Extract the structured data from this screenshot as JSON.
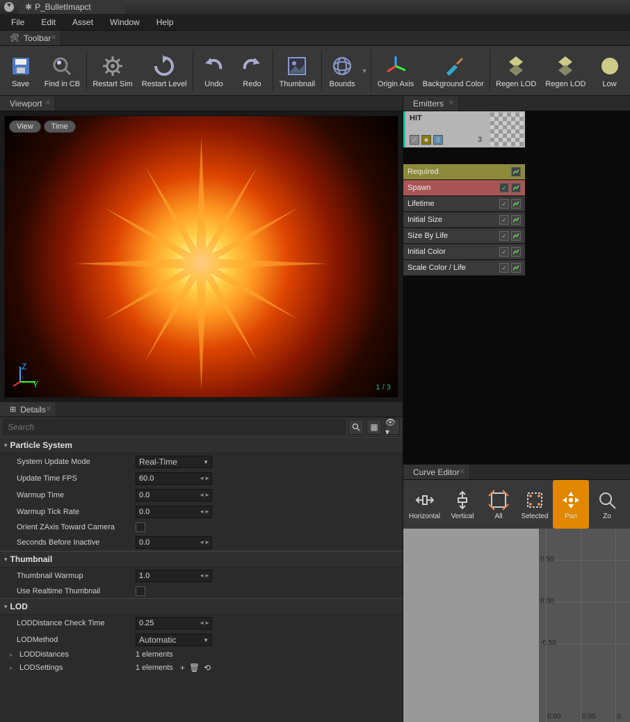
{
  "titlebar": {
    "doc_name": "P_BulletImapct"
  },
  "menubar": [
    "File",
    "Edit",
    "Asset",
    "Window",
    "Help"
  ],
  "toolbar_tab": "Toolbar",
  "toolbar": [
    {
      "label": "Save",
      "icon": "save"
    },
    {
      "label": "Find in CB",
      "icon": "find"
    },
    {
      "sep": true
    },
    {
      "label": "Restart Sim",
      "icon": "gear"
    },
    {
      "label": "Restart Level",
      "icon": "restart"
    },
    {
      "sep": true
    },
    {
      "label": "Undo",
      "icon": "undo"
    },
    {
      "label": "Redo",
      "icon": "redo"
    },
    {
      "sep": true
    },
    {
      "label": "Thumbnail",
      "icon": "thumb"
    },
    {
      "sep": true
    },
    {
      "label": "Bounds",
      "icon": "bounds",
      "dd": true
    },
    {
      "sep": true
    },
    {
      "label": "Origin Axis",
      "icon": "axis"
    },
    {
      "label": "Background Color",
      "icon": "brush"
    },
    {
      "sep": true
    },
    {
      "label": "Regen LOD",
      "icon": "lod"
    },
    {
      "label": "Regen LOD",
      "icon": "lod"
    },
    {
      "label": "Low",
      "icon": "low"
    }
  ],
  "viewport": {
    "tab": "Viewport",
    "view_btn": "View",
    "time_btn": "Time",
    "counter": "1 /  3"
  },
  "details": {
    "tab": "Details",
    "search_placeholder": "Search",
    "categories": [
      {
        "title": "Particle System",
        "rows": [
          {
            "label": "System Update Mode",
            "type": "combo",
            "value": "Real-Time"
          },
          {
            "label": "Update Time FPS",
            "type": "num",
            "value": "60.0"
          },
          {
            "label": "Warmup Time",
            "type": "num",
            "value": "0.0"
          },
          {
            "label": "Warmup Tick Rate",
            "type": "num",
            "value": "0.0"
          },
          {
            "label": "Orient ZAxis Toward Camera",
            "type": "check",
            "value": false
          },
          {
            "label": "Seconds Before Inactive",
            "type": "num",
            "value": "0.0"
          }
        ]
      },
      {
        "title": "Thumbnail",
        "rows": [
          {
            "label": "Thumbnail Warmup",
            "type": "num",
            "value": "1.0"
          },
          {
            "label": "Use Realtime Thumbnail",
            "type": "check",
            "value": false
          }
        ]
      },
      {
        "title": "LOD",
        "rows": [
          {
            "label": "LODDistance Check Time",
            "type": "num",
            "value": "0.25"
          },
          {
            "label": "LODMethod",
            "type": "combo",
            "value": "Automatic"
          },
          {
            "label": "LODDistances",
            "type": "array",
            "value": "1 elements",
            "expand": true
          },
          {
            "label": "LODSettings",
            "type": "array",
            "value": "1 elements",
            "expand": true,
            "extras": true
          }
        ]
      }
    ]
  },
  "emitters": {
    "tab": "Emitters",
    "name": "HIT",
    "count": "3",
    "modules": [
      {
        "label": "Required",
        "class": "required",
        "graph": true
      },
      {
        "label": "Spawn",
        "class": "spawn",
        "check": true,
        "graph": true
      },
      {
        "label": "Lifetime",
        "class": "normal",
        "check": true,
        "graph": true
      },
      {
        "label": "Initial Size",
        "class": "normal",
        "check": true,
        "graph": true
      },
      {
        "label": "Size By Life",
        "class": "normal",
        "check": true,
        "graph": true
      },
      {
        "label": "Initial Color",
        "class": "normal",
        "check": true,
        "graph": true
      },
      {
        "label": "Scale Color / Life",
        "class": "normal",
        "check": true,
        "graph": true
      }
    ]
  },
  "curve_editor": {
    "tab": "Curve Editor",
    "buttons": [
      {
        "label": "Horizontal",
        "icon": "fit-h"
      },
      {
        "label": "Vertical",
        "icon": "fit-v"
      },
      {
        "label": "All",
        "icon": "fit-all"
      },
      {
        "label": "Selected",
        "icon": "fit-sel"
      },
      {
        "label": "Pan",
        "icon": "pan",
        "active": true
      },
      {
        "label": "Zo",
        "icon": "zoom"
      }
    ],
    "y_ticks": [
      "0.50",
      "0.00",
      "-0.50"
    ],
    "x_ticks": [
      "0.00",
      "0.05",
      "0."
    ]
  }
}
